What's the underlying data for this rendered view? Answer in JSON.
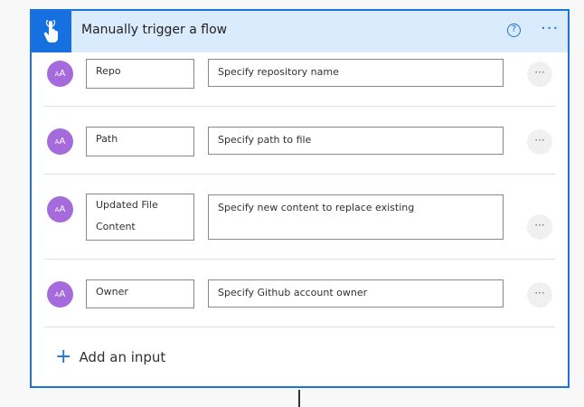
{
  "card": {
    "title": "Manually trigger a flow",
    "help_icon": "question-circle-icon",
    "help_glyph": "?",
    "menu_icon": "more-horizontal-icon",
    "menu_glyph": "···",
    "trigger_icon": "hand-touch-icon"
  },
  "inputs": [
    {
      "avatar": "AA",
      "name": "Repo",
      "description": "Specify repository name",
      "more": "···"
    },
    {
      "avatar": "AA",
      "name": "Path",
      "description": "Specify path to file",
      "more": "···"
    },
    {
      "avatar": "AA",
      "name": "Updated File Content",
      "description": "Specify new content to replace existing",
      "more": "···"
    },
    {
      "avatar": "AA",
      "name": "Owner",
      "description": "Specify Github account owner",
      "more": "···"
    }
  ],
  "add_input": {
    "label": "Add an input",
    "icon": "plus-icon",
    "glyph": "+"
  },
  "colors": {
    "accent": "#1b74d8",
    "header_bg": "#d9ebfd",
    "tile_bg": "#1770e0",
    "avatar_bg": "#a56bdc"
  }
}
